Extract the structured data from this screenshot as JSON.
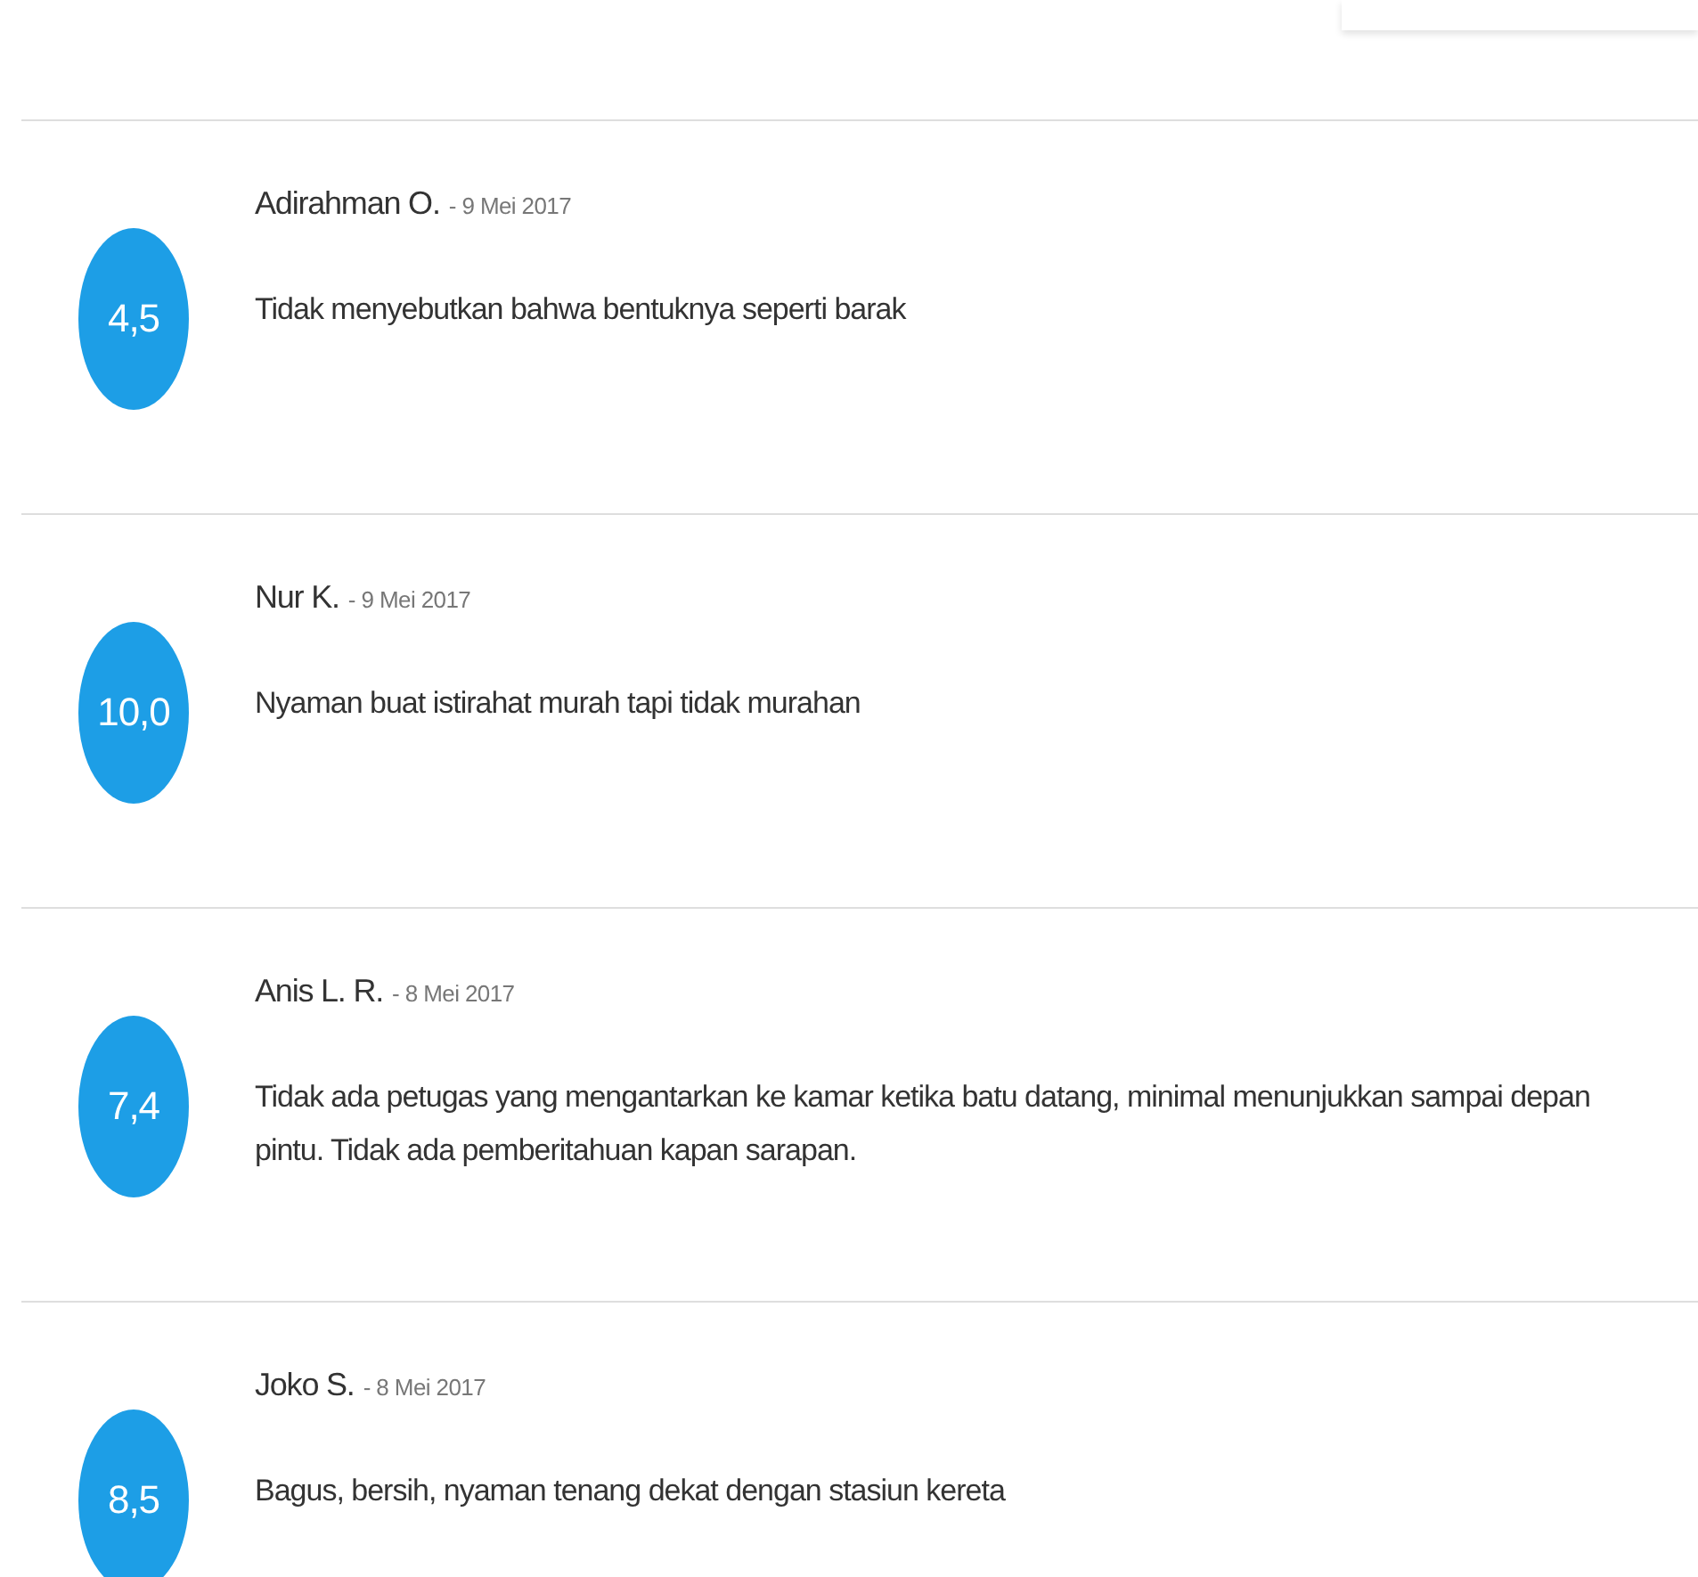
{
  "reviews": [
    {
      "name": "Adirahman O.",
      "date": "- 9 Mei 2017",
      "score": "4,5",
      "comment": "Tidak menyebutkan bahwa bentuknya seperti barak"
    },
    {
      "name": "Nur K.",
      "date": "- 9 Mei 2017",
      "score": "10,0",
      "comment": "Nyaman buat istirahat murah tapi tidak murahan"
    },
    {
      "name": "Anis L. R.",
      "date": "- 8 Mei 2017",
      "score": "7,4",
      "comment": "Tidak ada petugas yang mengantarkan ke kamar ketika batu datang, minimal menunjukkan sampai depan pintu. Tidak ada pemberitahuan kapan sarapan."
    },
    {
      "name": "Joko S.",
      "date": "- 8 Mei 2017",
      "score": "8,5",
      "comment": "Bagus, bersih, nyaman tenang dekat dengan stasiun kereta"
    }
  ]
}
